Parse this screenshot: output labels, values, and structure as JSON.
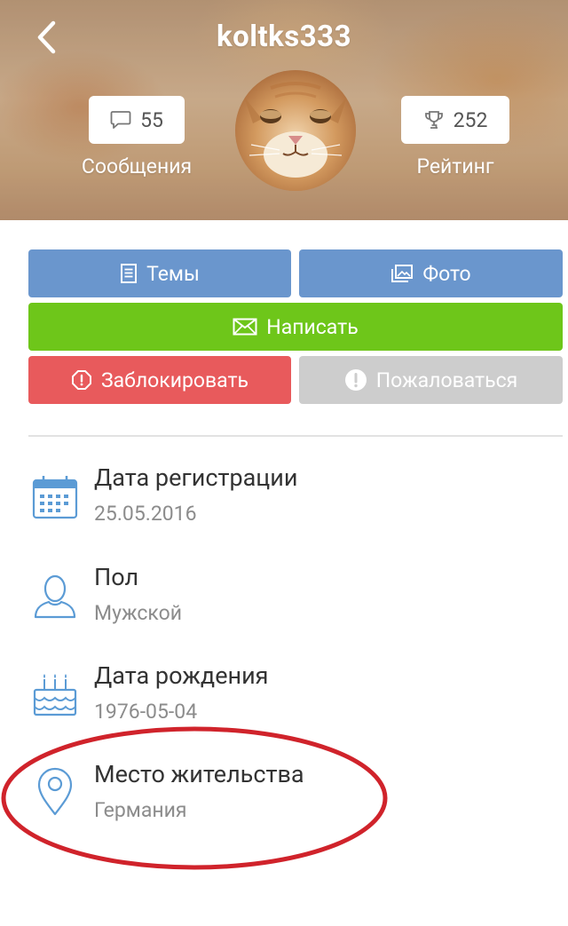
{
  "header": {
    "username": "koltks333",
    "messages": {
      "count": "55",
      "label": "Сообщения"
    },
    "rating": {
      "count": "252",
      "label": "Рейтинг"
    }
  },
  "buttons": {
    "topics": "Темы",
    "photo": "Фото",
    "write": "Написать",
    "block": "Заблокировать",
    "report": "Пожаловаться"
  },
  "info": [
    {
      "title": "Дата регистрации",
      "value": "25.05.2016",
      "icon": "calendar-icon"
    },
    {
      "title": "Пол",
      "value": "Мужской",
      "icon": "person-icon"
    },
    {
      "title": "Дата рождения",
      "value": "1976-05-04",
      "icon": "cake-icon"
    },
    {
      "title": "Место жительства",
      "value": "Германия",
      "icon": "location-pin-icon"
    }
  ],
  "colors": {
    "blue": "#6a96cd",
    "green": "#6ec61a",
    "red": "#e85a5c",
    "gray": "#cdcdcd",
    "icon_blue": "#5b9bd5",
    "highlight": "#d0232b"
  }
}
